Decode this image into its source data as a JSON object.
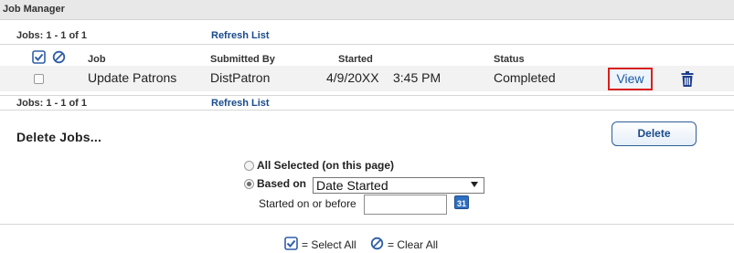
{
  "window": {
    "title": "Job Manager"
  },
  "pager": {
    "top_count": "Jobs: 1 - 1 of 1",
    "top_refresh": "Refresh List",
    "bottom_count": "Jobs: 1 - 1 of 1",
    "bottom_refresh": "Refresh List"
  },
  "table": {
    "columns": [
      "Job",
      "Submitted By",
      "Started",
      "Status"
    ],
    "rows": [
      {
        "job": "Update Patrons",
        "submitted_by": "DistPatron",
        "started_date": "4/9/20XX",
        "started_time": "3:45 PM",
        "status": "Completed",
        "action_label": "View"
      }
    ]
  },
  "delete_section": {
    "title": "Delete Jobs...",
    "delete_button": "Delete",
    "option_all": "All Selected (on this page)",
    "option_based_on": "Based on",
    "based_on_select": "Date Started",
    "started_label": "Started on or before",
    "started_value": "",
    "calendar_icon_text": "31"
  },
  "legend": {
    "select_all": "= Select All",
    "clear_all": "= Clear All"
  },
  "colors": {
    "accent": "#1a4b8c",
    "highlight_border": "#d9201e",
    "trash_icon": "#1f3f8f"
  }
}
